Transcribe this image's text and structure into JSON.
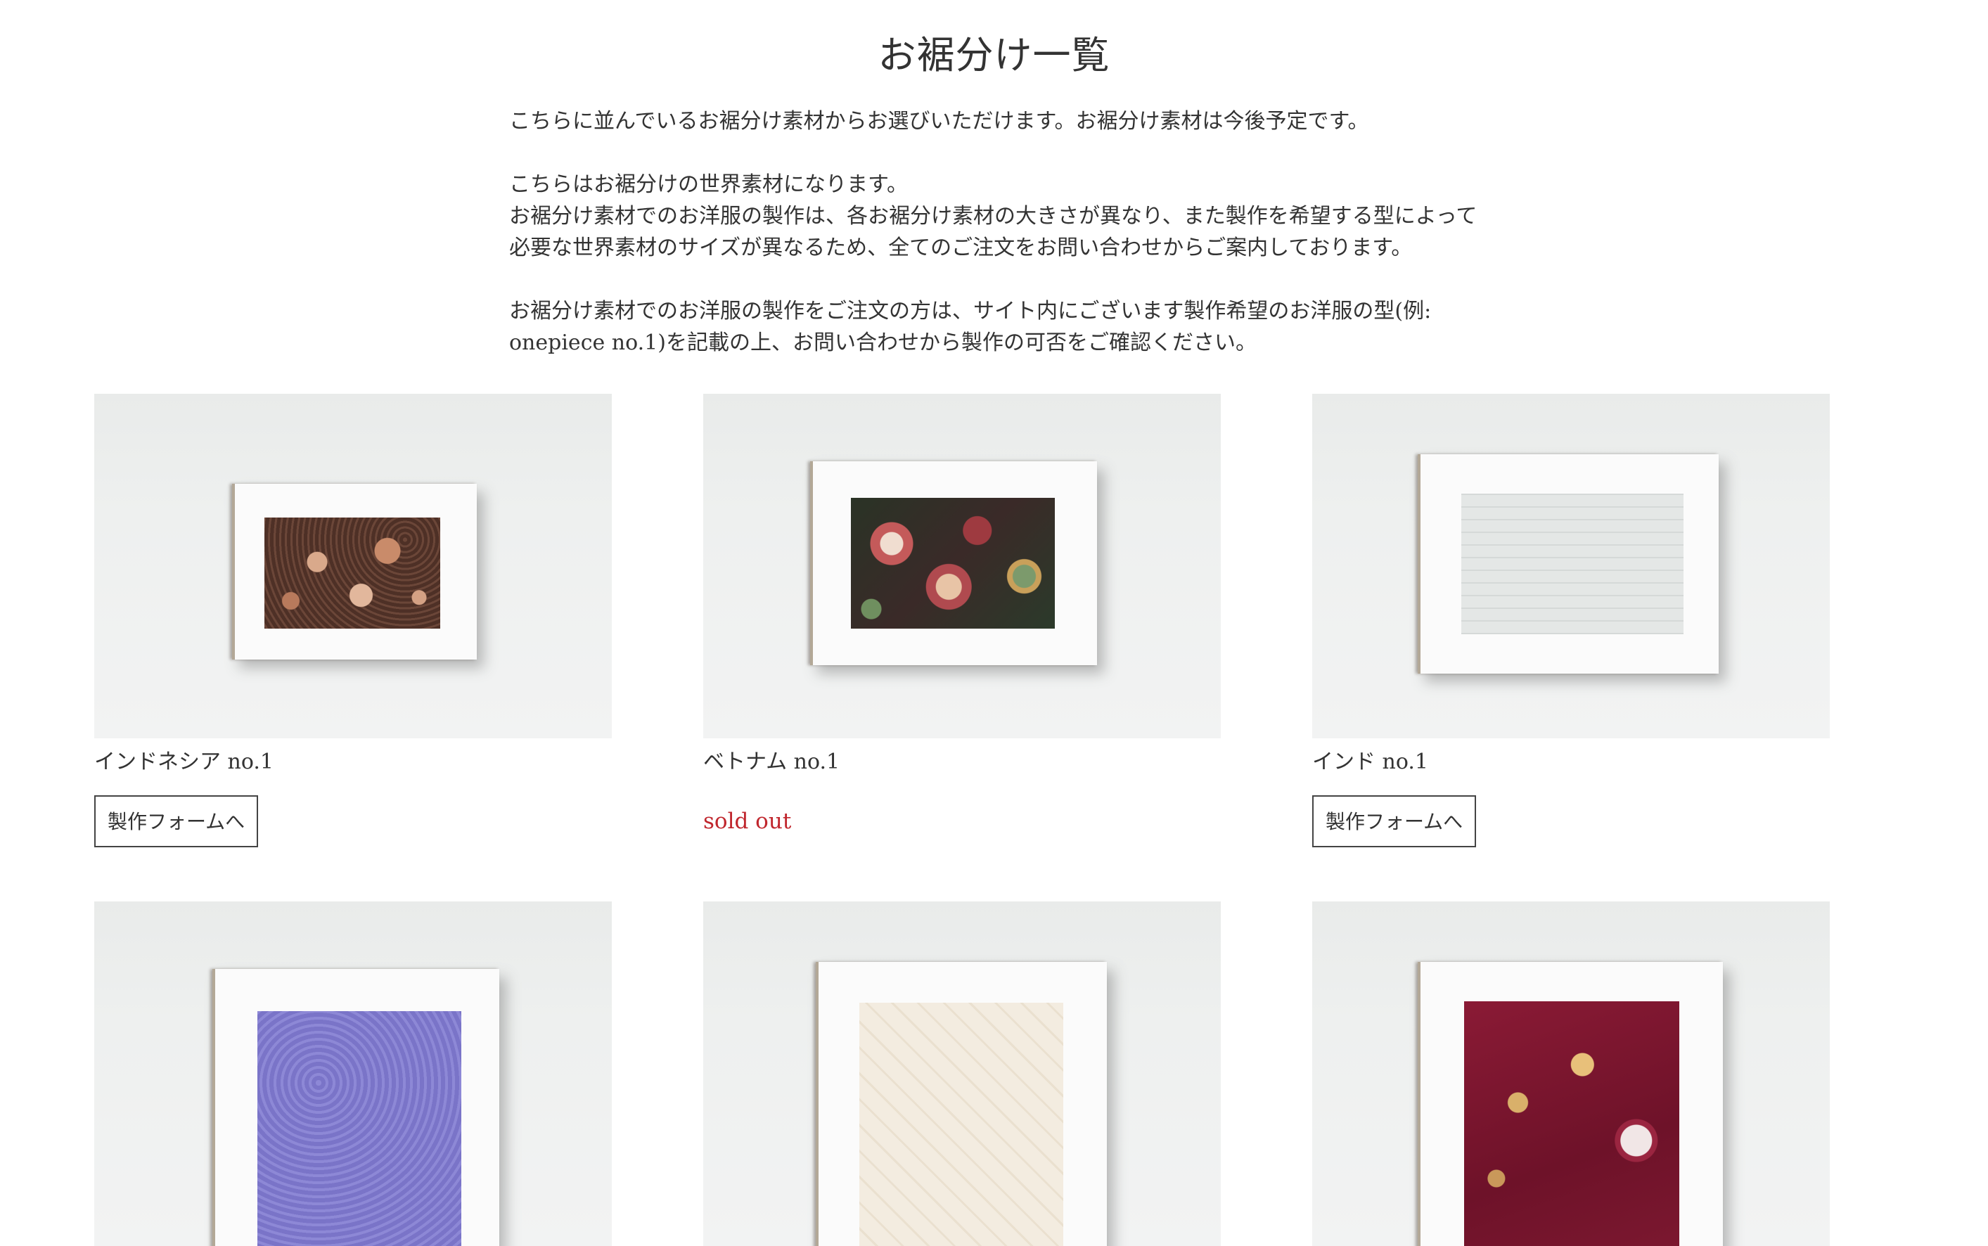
{
  "page": {
    "title": "お裾分け一覧",
    "intro": [
      "こちらに並んでいるお裾分け素材からお選びいただけます。お裾分け素材は今後予定です。",
      "こちらはお裾分けの世界素材になります。\nお裾分け素材でのお洋服の製作は、各お裾分け素材の大きさが異なり、また製作を希望する型によって\n必要な世界素材のサイズが異なるため、全てのご注文をお問い合わせからご案内しております。",
      "お裾分け素材でのお洋服の製作をご注文の方は、サイト内にございます製作希望のお洋服の型(例:\nonepiece no.1)を記載の上、お問い合わせから製作の可否をご確認ください。"
    ]
  },
  "products": [
    {
      "name": "インドネシア no.1",
      "button_label": "製作フォームへ",
      "status": "available",
      "fabric_icon": "brown-floral-batik-fabric"
    },
    {
      "name": "ベトナム no.1",
      "status_label": "sold out",
      "status": "sold_out",
      "fabric_icon": "red-green-floral-brocade-fabric"
    },
    {
      "name": "インド no.1",
      "button_label": "製作フォームへ",
      "status": "available",
      "fabric_icon": "silver-embroidered-fabric"
    },
    {
      "name": "",
      "status": "unknown",
      "fabric_icon": "lavender-paisley-fabric"
    },
    {
      "name": "",
      "status": "unknown",
      "fabric_icon": "cream-jacquard-fabric"
    },
    {
      "name": "",
      "status": "unknown",
      "fabric_icon": "burgundy-floral-satin-fabric"
    }
  ],
  "colors": {
    "text": "#333333",
    "sold_out": "#c0262d",
    "button_border": "#444444"
  }
}
